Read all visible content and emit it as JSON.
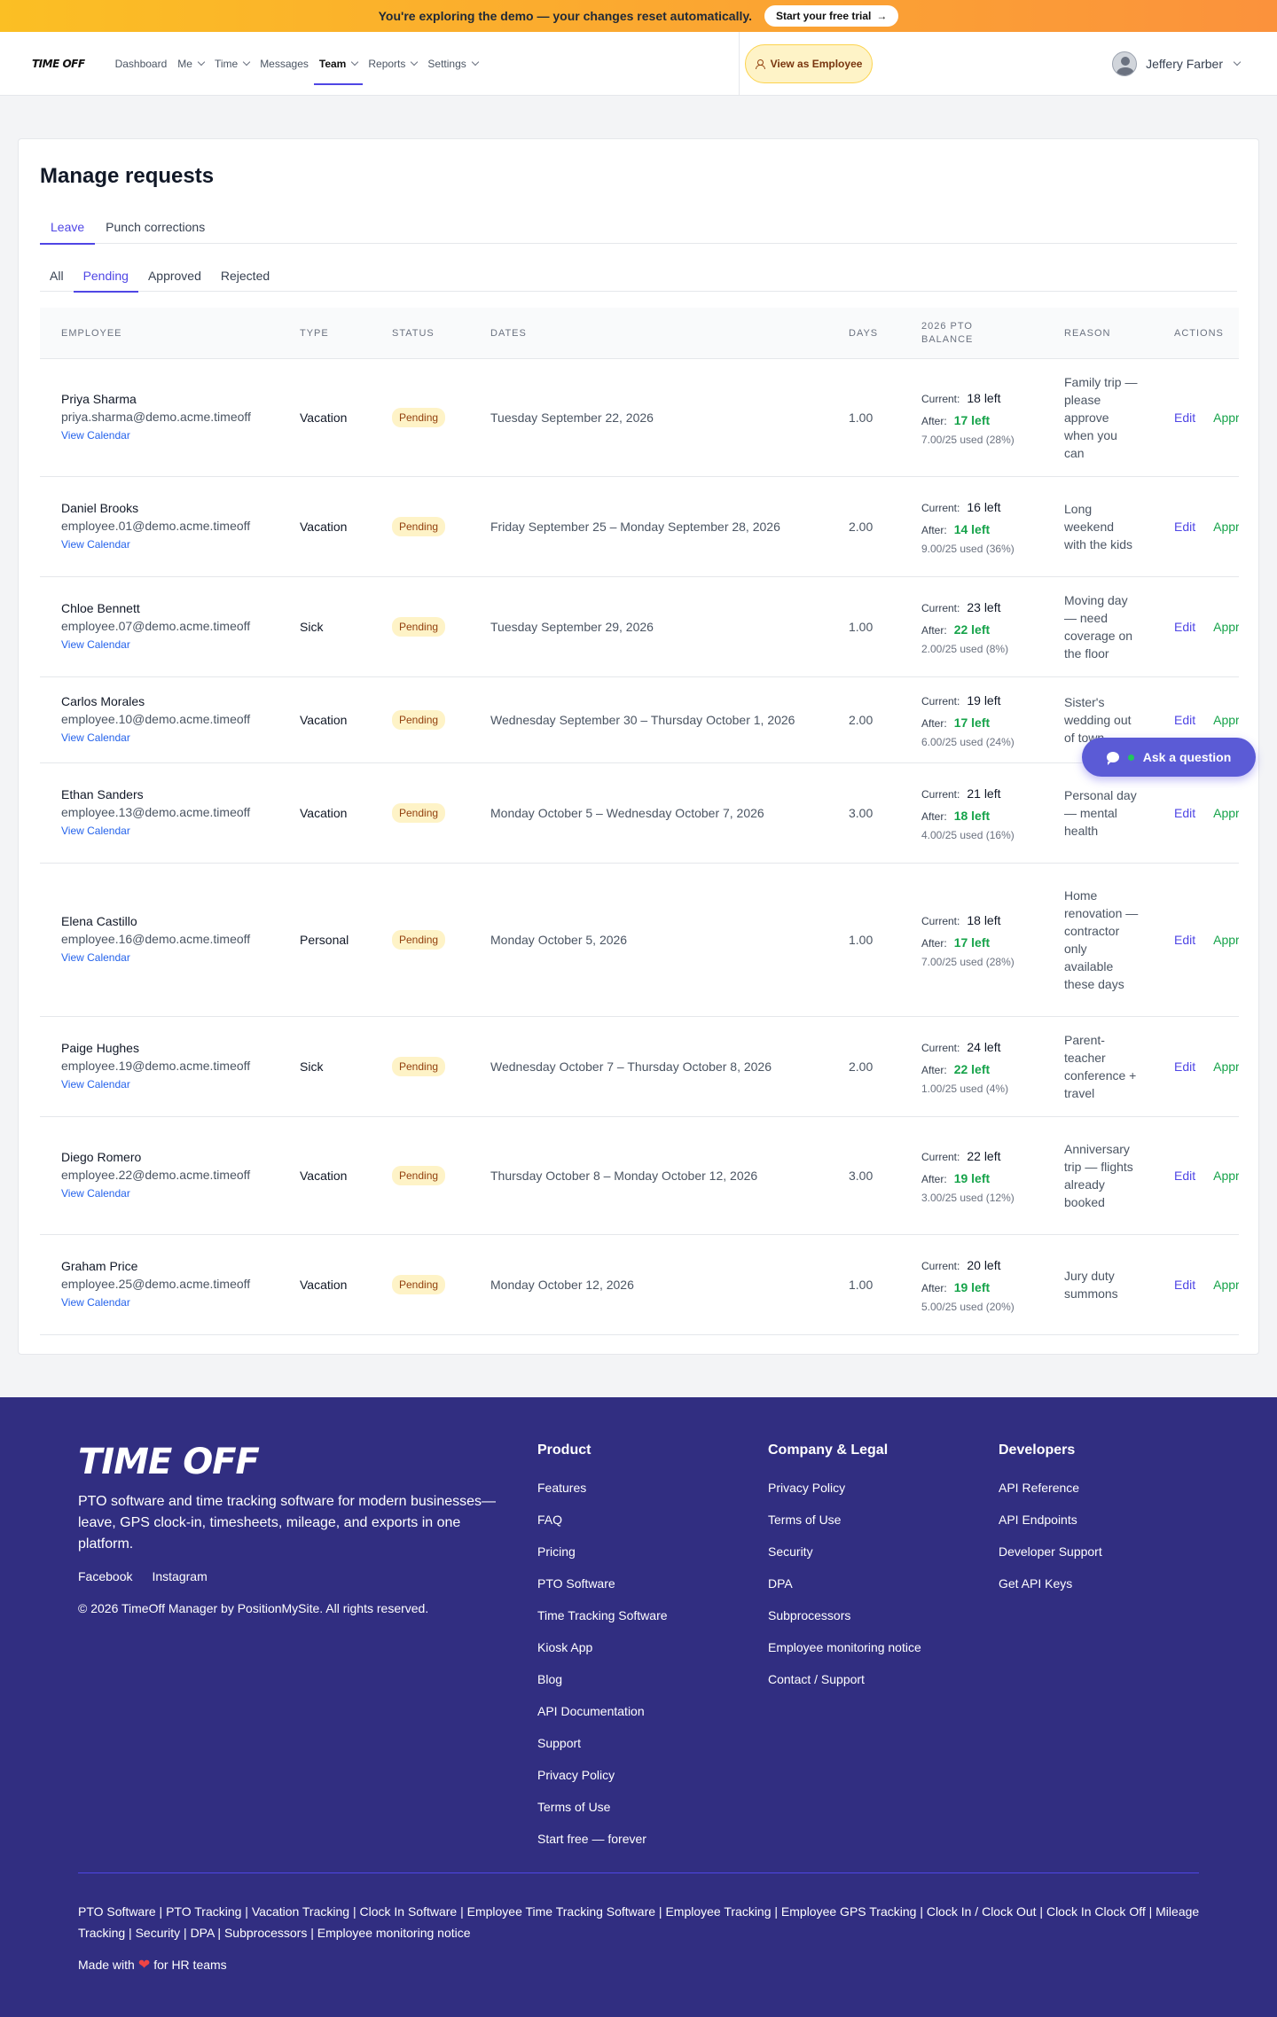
{
  "banner": {
    "text": "You're exploring the demo — your changes reset automatically.",
    "cta": "Start your free trial",
    "cta_arrow": "→"
  },
  "nav": {
    "logo": "TIME OFF",
    "items": [
      {
        "label": "Dashboard",
        "dropdown": false
      },
      {
        "label": "Me",
        "dropdown": true
      },
      {
        "label": "Time",
        "dropdown": true
      },
      {
        "label": "Messages",
        "dropdown": false
      },
      {
        "label": "Team",
        "dropdown": true,
        "active": true
      },
      {
        "label": "Reports",
        "dropdown": true
      },
      {
        "label": "Settings",
        "dropdown": true
      }
    ],
    "view_as": "View as Employee",
    "user_name": "Jeffery Farber"
  },
  "page": {
    "title": "Manage requests",
    "tabs": [
      "Leave",
      "Punch corrections"
    ],
    "filters": [
      "All",
      "Pending",
      "Approved",
      "Rejected"
    ]
  },
  "table": {
    "headers": {
      "employee": "EMPLOYEE",
      "type": "TYPE",
      "status": "STATUS",
      "dates": "DATES",
      "days": "DAYS",
      "balance_1": "2026 PTO",
      "balance_2": "BALANCE",
      "reason": "REASON",
      "actions": "ACTIONS"
    },
    "labels": {
      "current": "Current:",
      "after": "After:",
      "view_calendar": "View Calendar",
      "edit": "Edit",
      "approve": "Approve"
    },
    "rows": [
      {
        "name": "Priya Sharma",
        "email": "priya.sharma@demo.acme.timeoff",
        "type": "Vacation",
        "status": "Pending",
        "dates": "Tuesday September 22, 2026",
        "days": "1.00",
        "current": "18 left",
        "after": "17 left",
        "used": "7.00/25 used (28%)",
        "reason": "Family trip — please approve when you can"
      },
      {
        "name": "Daniel Brooks",
        "email": "employee.01@demo.acme.timeoff",
        "type": "Vacation",
        "status": "Pending",
        "dates": "Friday September 25 – Monday September 28, 2026",
        "days": "2.00",
        "current": "16 left",
        "after": "14 left",
        "used": "9.00/25 used (36%)",
        "reason": "Long weekend with the kids"
      },
      {
        "name": "Chloe Bennett",
        "email": "employee.07@demo.acme.timeoff",
        "type": "Sick",
        "status": "Pending",
        "dates": "Tuesday September 29, 2026",
        "days": "1.00",
        "current": "23 left",
        "after": "22 left",
        "used": "2.00/25 used (8%)",
        "reason": "Moving day — need coverage on the floor"
      },
      {
        "name": "Carlos Morales",
        "email": "employee.10@demo.acme.timeoff",
        "type": "Vacation",
        "status": "Pending",
        "dates": "Wednesday September 30 – Thursday October 1, 2026",
        "days": "2.00",
        "current": "19 left",
        "after": "17 left",
        "used": "6.00/25 used (24%)",
        "reason": "Sister's wedding out of town"
      },
      {
        "name": "Ethan Sanders",
        "email": "employee.13@demo.acme.timeoff",
        "type": "Vacation",
        "status": "Pending",
        "dates": "Monday October 5 – Wednesday October 7, 2026",
        "days": "3.00",
        "current": "21 left",
        "after": "18 left",
        "used": "4.00/25 used (16%)",
        "reason": "Personal day — mental health"
      },
      {
        "name": "Elena Castillo",
        "email": "employee.16@demo.acme.timeoff",
        "type": "Personal",
        "status": "Pending",
        "dates": "Monday October 5, 2026",
        "days": "1.00",
        "current": "18 left",
        "after": "17 left",
        "used": "7.00/25 used (28%)",
        "reason": "Home renovation — contractor only available these days"
      },
      {
        "name": "Paige Hughes",
        "email": "employee.19@demo.acme.timeoff",
        "type": "Sick",
        "status": "Pending",
        "dates": "Wednesday October 7 – Thursday October 8, 2026",
        "days": "2.00",
        "current": "24 left",
        "after": "22 left",
        "used": "1.00/25 used (4%)",
        "reason": "Parent-teacher conference + travel"
      },
      {
        "name": "Diego Romero",
        "email": "employee.22@demo.acme.timeoff",
        "type": "Vacation",
        "status": "Pending",
        "dates": "Thursday October 8 – Monday October 12, 2026",
        "days": "3.00",
        "current": "22 left",
        "after": "19 left",
        "used": "3.00/25 used (12%)",
        "reason": "Anniversary trip — flights already booked"
      },
      {
        "name": "Graham Price",
        "email": "employee.25@demo.acme.timeoff",
        "type": "Vacation",
        "status": "Pending",
        "dates": "Monday October 12, 2026",
        "days": "1.00",
        "current": "20 left",
        "after": "19 left",
        "used": "5.00/25 used (20%)",
        "reason": "Jury duty summons"
      }
    ]
  },
  "ask": {
    "label": "Ask a question"
  },
  "footer": {
    "logo": "TIME OFF",
    "description": "PTO software and time tracking software for modern businesses—leave, GPS clock-in, timesheets, mileage, and exports in one platform.",
    "social": [
      "Facebook",
      "Instagram"
    ],
    "copyright": "© 2026 TimeOff Manager by PositionMySite. All rights reserved.",
    "columns": [
      {
        "title": "Product",
        "links": [
          "Features",
          "FAQ",
          "Pricing",
          "PTO Software",
          "Time Tracking Software",
          "Kiosk App",
          "Blog",
          "API Documentation",
          "Support",
          "Privacy Policy",
          "Terms of Use",
          "Start free — forever"
        ]
      },
      {
        "title": "Company & Legal",
        "links": [
          "Privacy Policy",
          "Terms of Use",
          "Security",
          "DPA",
          "Subprocessors",
          "Employee monitoring notice",
          "Contact / Support"
        ]
      },
      {
        "title": "Developers",
        "links": [
          "API Reference",
          "API Endpoints",
          "Developer Support",
          "Get API Keys"
        ]
      }
    ],
    "bottom_links": "PTO Software | PTO Tracking | Vacation Tracking | Clock In Software | Employee Time Tracking Software | Employee Tracking | Employee GPS Tracking | Clock In / Clock Out | Clock In Clock Off | Mileage Tracking | Security | DPA | Subprocessors | Employee monitoring notice",
    "made_with_pre": "Made with",
    "made_with_post": "for HR teams"
  }
}
